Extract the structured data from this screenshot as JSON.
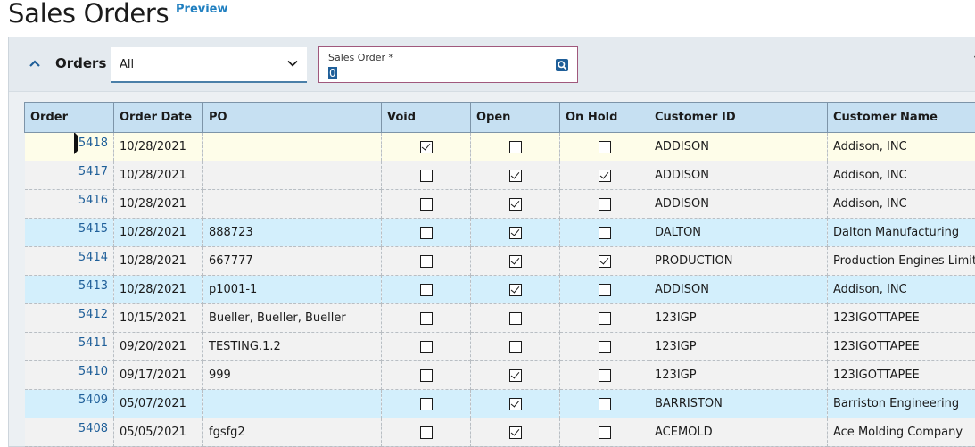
{
  "header": {
    "title": "Sales Orders",
    "preview_label": "Preview"
  },
  "toolbar": {
    "section_label": "Orders",
    "filter_value": "All",
    "sales_order_label": "Sales Order *",
    "sales_order_value": "0"
  },
  "grid": {
    "columns": [
      "Order",
      "Order Date",
      "PO",
      "Void",
      "Open",
      "On Hold",
      "Customer ID",
      "Customer Name"
    ],
    "rows": [
      {
        "order": "5418",
        "date": "10/28/2021",
        "po": "",
        "void": true,
        "open": false,
        "hold": false,
        "customer_id": "ADDISON",
        "customer_name": "Addison, INC",
        "style": "selected"
      },
      {
        "order": "5417",
        "date": "10/28/2021",
        "po": "",
        "void": false,
        "open": true,
        "hold": true,
        "customer_id": "ADDISON",
        "customer_name": "Addison, INC",
        "style": "default"
      },
      {
        "order": "5416",
        "date": "10/28/2021",
        "po": "",
        "void": false,
        "open": true,
        "hold": false,
        "customer_id": "ADDISON",
        "customer_name": "Addison, INC",
        "style": "default"
      },
      {
        "order": "5415",
        "date": "10/28/2021",
        "po": "888723",
        "void": false,
        "open": true,
        "hold": false,
        "customer_id": "DALTON",
        "customer_name": "Dalton Manufacturing",
        "style": "blue"
      },
      {
        "order": "5414",
        "date": "10/28/2021",
        "po": "667777",
        "void": false,
        "open": true,
        "hold": true,
        "customer_id": "PRODUCTION",
        "customer_name": "Production Engines Limited",
        "style": "default"
      },
      {
        "order": "5413",
        "date": "10/28/2021",
        "po": "p1001-1",
        "void": false,
        "open": true,
        "hold": false,
        "customer_id": "ADDISON",
        "customer_name": "Addison, INC",
        "style": "blue"
      },
      {
        "order": "5412",
        "date": "10/15/2021",
        "po": "Bueller, Bueller, Bueller",
        "void": false,
        "open": false,
        "hold": false,
        "customer_id": "123IGP",
        "customer_name": "123IGOTTAPEE",
        "style": "default"
      },
      {
        "order": "5411",
        "date": "09/20/2021",
        "po": "TESTING.1.2",
        "void": false,
        "open": false,
        "hold": false,
        "customer_id": "123IGP",
        "customer_name": "123IGOTTAPEE",
        "style": "default"
      },
      {
        "order": "5410",
        "date": "09/17/2021",
        "po": "999",
        "void": false,
        "open": true,
        "hold": false,
        "customer_id": "123IGP",
        "customer_name": "123IGOTTAPEE",
        "style": "default"
      },
      {
        "order": "5409",
        "date": "05/07/2021",
        "po": "",
        "void": false,
        "open": true,
        "hold": false,
        "customer_id": "BARRISTON",
        "customer_name": "Barriston Engineering",
        "style": "blue"
      },
      {
        "order": "5408",
        "date": "05/05/2021",
        "po": "fgsfg2",
        "void": false,
        "open": true,
        "hold": false,
        "customer_id": "ACEMOLD",
        "customer_name": "Ace Molding Company",
        "style": "default"
      }
    ]
  },
  "colors": {
    "header_blue": "#c6e0f2",
    "row_blue": "#d3effc",
    "row_selected": "#fefde9",
    "link": "#1f5f99"
  }
}
